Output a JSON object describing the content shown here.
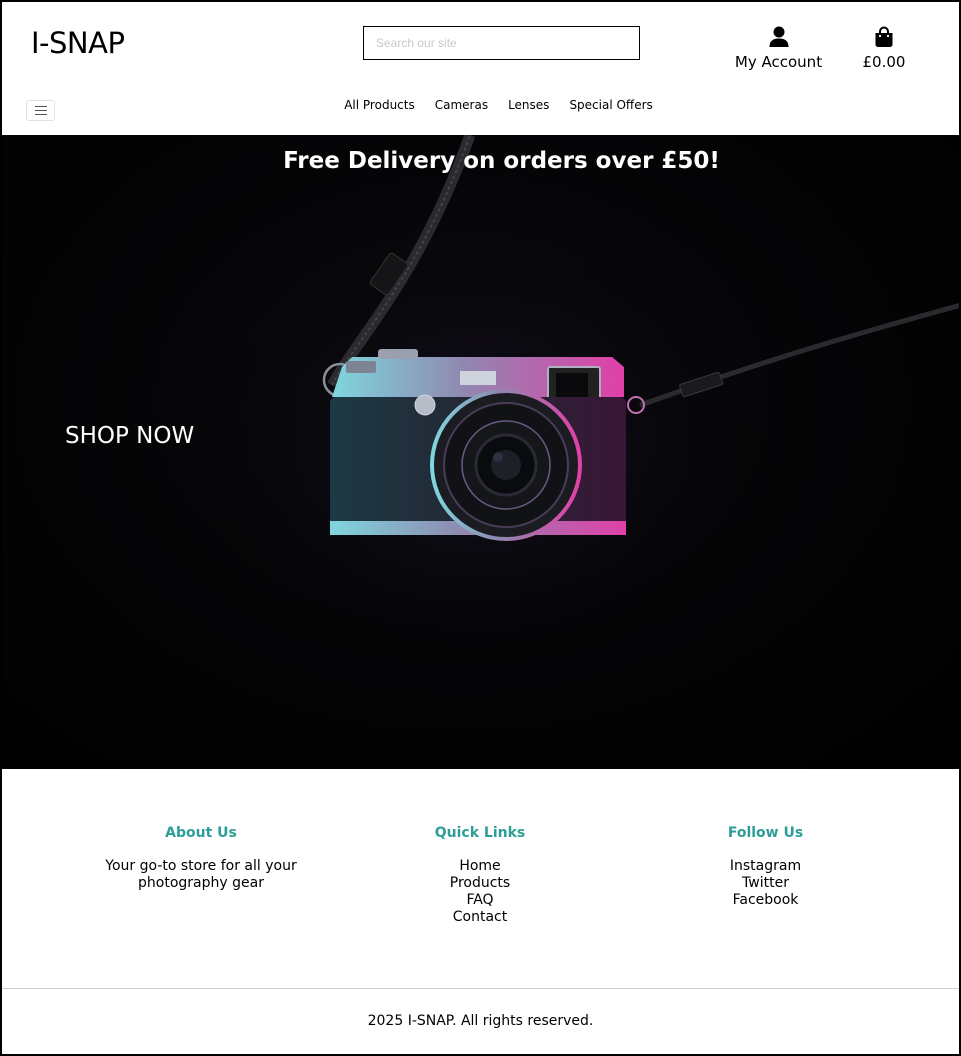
{
  "header": {
    "logo": "I-SNAP",
    "search": {
      "placeholder": "Search our site",
      "value": ""
    },
    "account_label": "My Account",
    "cart_total": "£0.00"
  },
  "nav": {
    "items": [
      {
        "label": "All Products"
      },
      {
        "label": "Cameras"
      },
      {
        "label": "Lenses"
      },
      {
        "label": "Special Offers"
      }
    ]
  },
  "hero": {
    "banner": "Free Delivery on orders over £50!",
    "cta": "SHOP NOW"
  },
  "footer": {
    "about": {
      "title": "About Us",
      "text": "Your go-to store for all your photography gear"
    },
    "quick_links": {
      "title": "Quick Links",
      "links": [
        "Home",
        "Products",
        "FAQ",
        "Contact"
      ]
    },
    "follow": {
      "title": "Follow Us",
      "links": [
        "Instagram",
        "Twitter",
        "Facebook"
      ]
    },
    "copyright": "2025 I-SNAP. All rights reserved."
  },
  "colors": {
    "accent": "#2d9e97",
    "hero_bg": "#000000"
  },
  "icons": [
    "user-icon",
    "shopping-bag-icon",
    "hamburger-menu-icon"
  ]
}
